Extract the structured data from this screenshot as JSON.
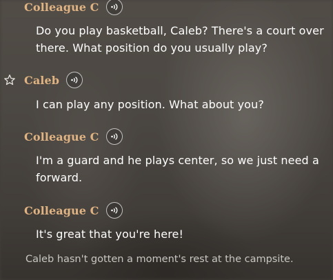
{
  "entries": [
    {
      "speaker": "Colleague C",
      "text": "Do you play basketball, Caleb? There's a court over there. What position do you usually play?"
    },
    {
      "speaker": "Caleb",
      "text": "I can play any position. What about you?"
    },
    {
      "speaker": "Colleague C",
      "text": "I'm a guard and he plays center, so we just need a forward."
    },
    {
      "speaker": "Colleague C",
      "text": "It's great that you're here!"
    }
  ],
  "narration": "Caleb hasn't gotten a moment's rest at the campsite.",
  "icons": {
    "voice": "voice-replay-icon",
    "favorite": "star-outline-icon"
  },
  "colors": {
    "speaker_name": "#e0b383",
    "dialogue_text": "#ffffff",
    "narration_text": "#c9c7c2"
  }
}
